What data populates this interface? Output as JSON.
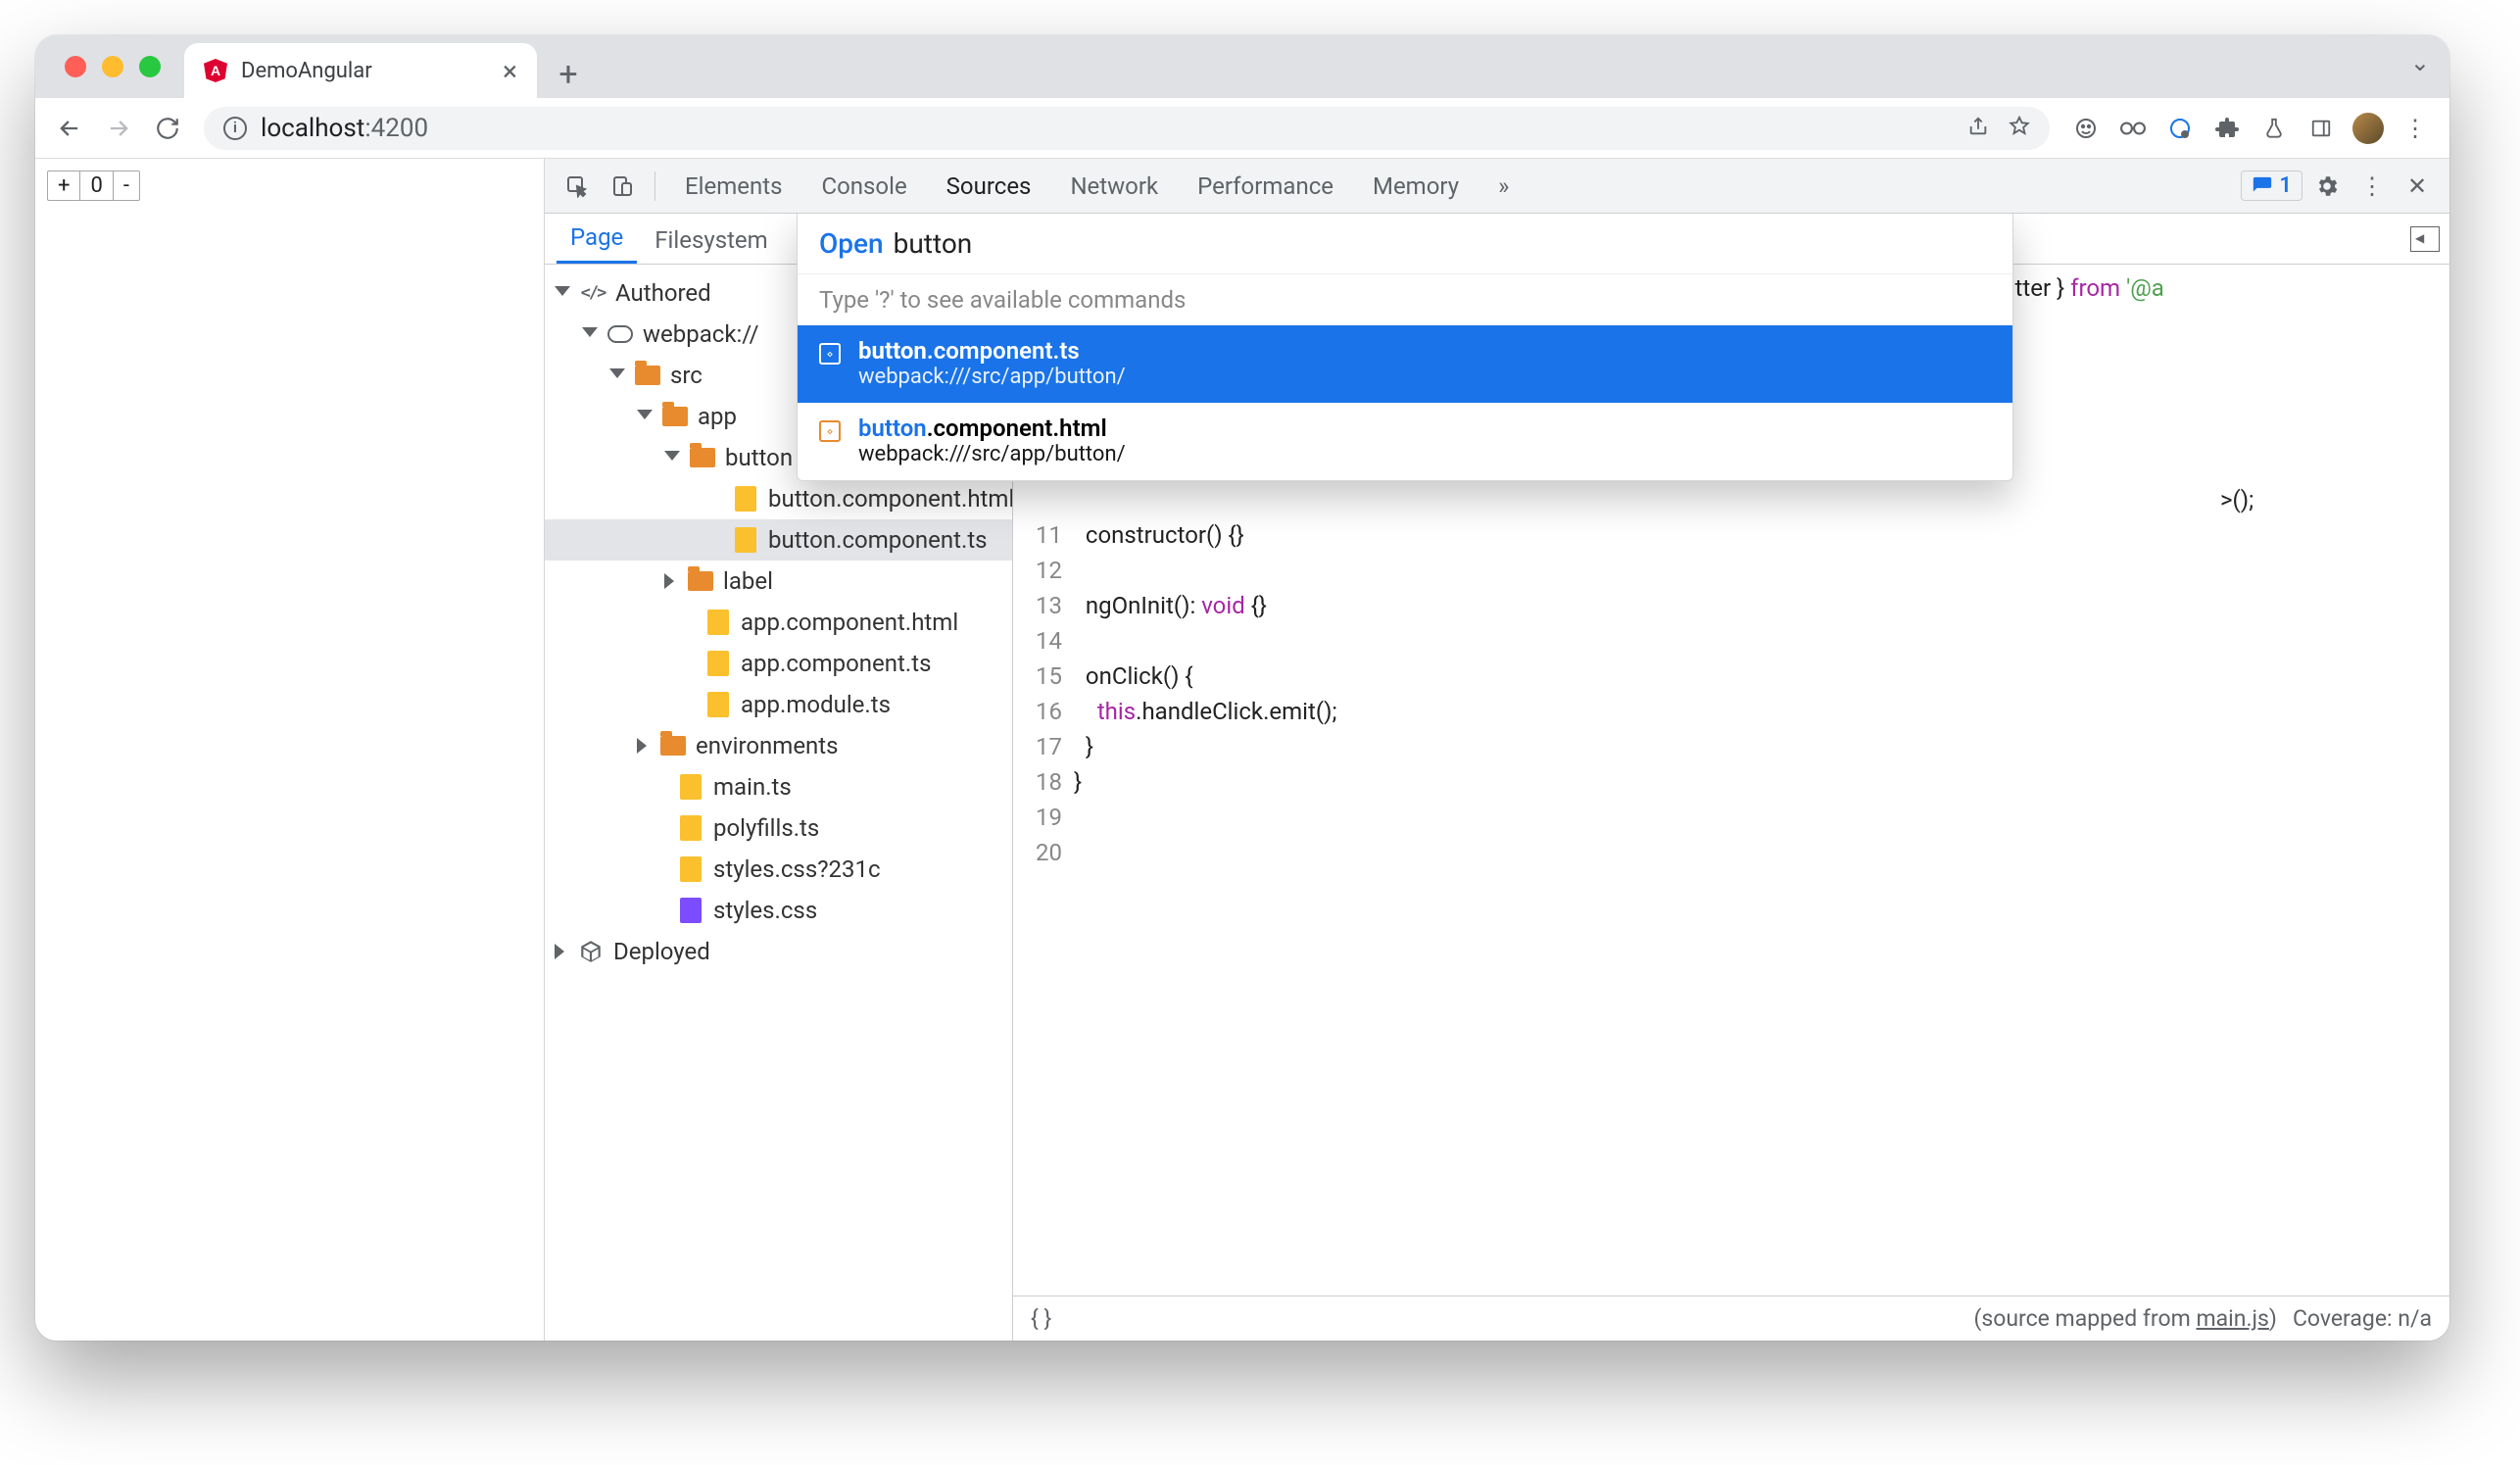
{
  "window": {
    "tab_title": "DemoAngular",
    "url_host": "localhost",
    "url_port": ":4200"
  },
  "page_widget": {
    "plus": "+",
    "zero": "0",
    "minus": "-"
  },
  "devtools": {
    "tabs": [
      "Elements",
      "Console",
      "Sources",
      "Network",
      "Performance",
      "Memory"
    ],
    "active": "Sources",
    "issue_badge": "1",
    "side_tabs": {
      "page": "Page",
      "fs": "Filesystem"
    },
    "tree": {
      "root": "Authored",
      "webpack": "webpack://",
      "src": "src",
      "app": "app",
      "button": "button",
      "but_html": "button.component.html",
      "but_ts": "button.component.ts",
      "label": "label",
      "app_html": "app.component.html",
      "app_ts": "app.component.ts",
      "app_mod": "app.module.ts",
      "envs": "environments",
      "main": "main.ts",
      "poly": "polyfills.ts",
      "styles_q": "styles.css?231c",
      "styles": "styles.css",
      "deployed": "Deployed"
    }
  },
  "palette": {
    "open_label": "Open",
    "query": "button",
    "hint": "Type '?' to see available commands",
    "r0_name": "button.component.ts",
    "r0_hl": "button",
    "r0_rest": ".component.ts",
    "r0_path": "webpack:///src/app/button/",
    "r1_name": "button.component.html",
    "r1_hl": "button",
    "r1_rest": ".component.html",
    "r1_path": "webpack:///src/app/button/"
  },
  "code": {
    "gutter": "\n\n\n\n\n\n\n11\n12\n13\n14\n15\n16\n17\n18\n19\n20",
    "frag_emitter": "Emitter } ",
    "frag_from": "from",
    "frag_at_a": " '@a",
    "line_ctor": "  constructor() {}",
    "line_ng": "  ngOnInit(): ",
    "line_ng_void": "void",
    "line_ng_end": " {}",
    "line_onclick": "  onClick() {",
    "line_emit1": "    ",
    "line_emit_this": "this",
    "line_emit2": ".handleClick.emit();",
    "line_closebrace": "  }",
    "line_close2": "}",
    "line_new": ">();"
  },
  "status": {
    "mapped": "(source mapped from ",
    "mapped_link": "main.js",
    "mapped_end": ")",
    "coverage": "Coverage: n/a"
  }
}
